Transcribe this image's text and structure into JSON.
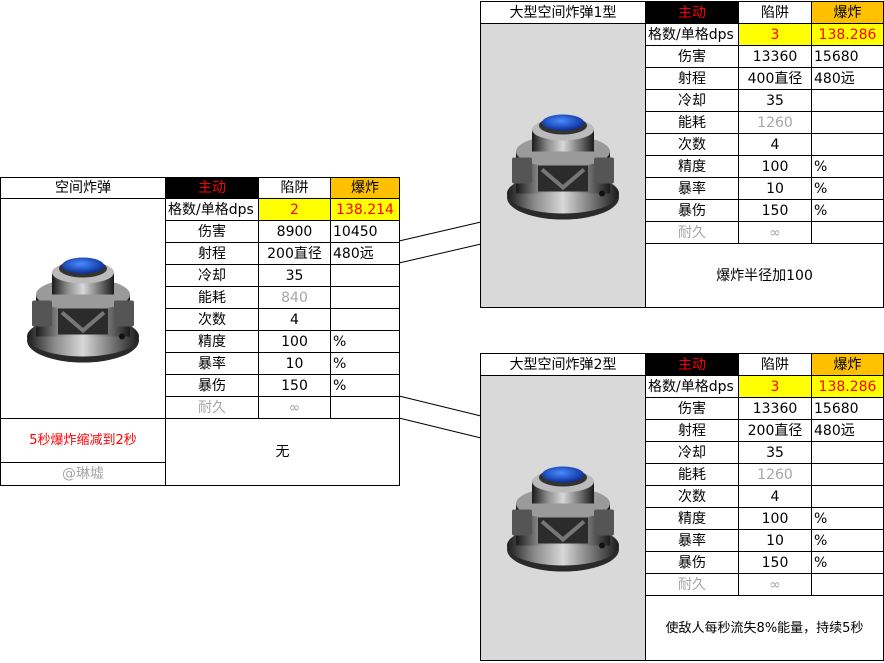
{
  "stat_labels": [
    "伤害",
    "射程",
    "冷却",
    "能耗",
    "次数",
    "精度",
    "暴率",
    "暴伤",
    "耐久"
  ],
  "header": {
    "mode_active": "主动",
    "mode_trap": "陷阱",
    "mode_burst": "爆炸"
  },
  "dps_label": "格数/单格dps",
  "colors": {
    "active_text": "#ff0000",
    "grid_highlight": "#ffff00",
    "burst_highlight": "#ffc000"
  },
  "cards": {
    "basic": {
      "name": "空间炸弹",
      "grid_count": "2",
      "dps": "138.214",
      "trap": [
        "8900",
        "200直径",
        "35",
        "840",
        "4",
        "100",
        "10",
        "150",
        "∞"
      ],
      "burst": [
        "10450",
        "480远",
        "",
        "",
        "",
        "%",
        "%",
        "%",
        ""
      ],
      "bottom_left": "5秒爆炸缩减到2秒",
      "bottom_right": "无",
      "credit": "@琳墟"
    },
    "large1": {
      "name": "大型空间炸弹1型",
      "grid_count": "3",
      "dps": "138.286",
      "trap": [
        "13360",
        "400直径",
        "35",
        "1260",
        "4",
        "100",
        "10",
        "150",
        "∞"
      ],
      "burst": [
        "15680",
        "480远",
        "",
        "",
        "",
        "%",
        "%",
        "%",
        ""
      ],
      "note": "爆炸半径加100"
    },
    "large2": {
      "name": "大型空间炸弹2型",
      "grid_count": "3",
      "dps": "138.286",
      "trap": [
        "13360",
        "200直径",
        "35",
        "1260",
        "4",
        "100",
        "10",
        "150",
        "∞"
      ],
      "burst": [
        "15680",
        "480远",
        "",
        "",
        "",
        "%",
        "%",
        "%",
        ""
      ],
      "note": "使敌人每秒流失8%能量，持续5秒"
    }
  }
}
